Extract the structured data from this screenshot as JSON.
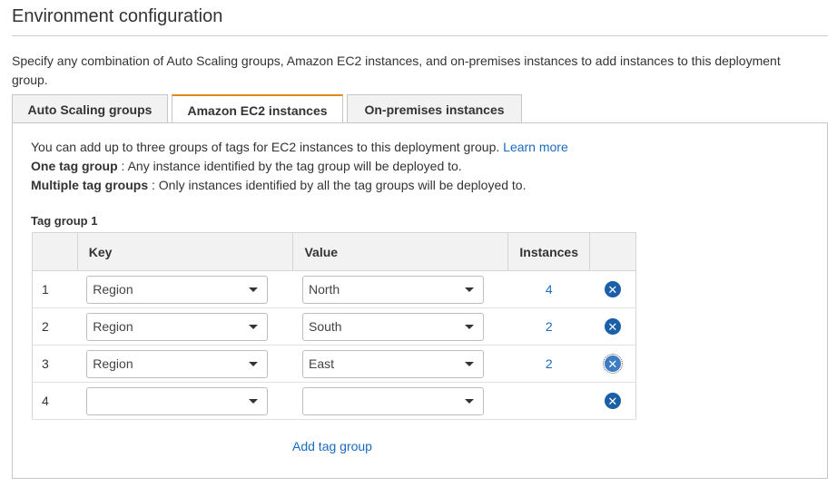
{
  "section": {
    "title": "Environment configuration",
    "description": "Specify any combination of Auto Scaling groups, Amazon EC2 instances, and on-premises instances to add instances to this deployment group."
  },
  "tabs": [
    {
      "label": "Auto Scaling groups",
      "active": false
    },
    {
      "label": "Amazon EC2 instances",
      "active": true
    },
    {
      "label": "On-premises instances",
      "active": false
    }
  ],
  "info": {
    "line1": "You can add up to three groups of tags for EC2 instances to this deployment group.",
    "learn_more": "Learn more",
    "one_tag_label": "One tag group",
    "one_tag_text": " : Any instance identified by the tag group will be deployed to.",
    "multi_tag_label": "Multiple tag groups",
    "multi_tag_text": " : Only instances identified by all the tag groups will be deployed to."
  },
  "tag_group": {
    "label": "Tag group 1",
    "columns": [
      "",
      "Key",
      "Value",
      "Instances",
      ""
    ],
    "rows": [
      {
        "index": "1",
        "key": "Region",
        "value": "North",
        "instances": "4"
      },
      {
        "index": "2",
        "key": "Region",
        "value": "South",
        "instances": "2"
      },
      {
        "index": "3",
        "key": "Region",
        "value": "East",
        "instances": "2"
      },
      {
        "index": "4",
        "key": "",
        "value": "",
        "instances": ""
      }
    ]
  },
  "add_tag_group": "Add tag group",
  "colors": {
    "accent_tab": "#e08a17",
    "link": "#1a6bbf",
    "remove_icon": "#1a5fa8"
  }
}
